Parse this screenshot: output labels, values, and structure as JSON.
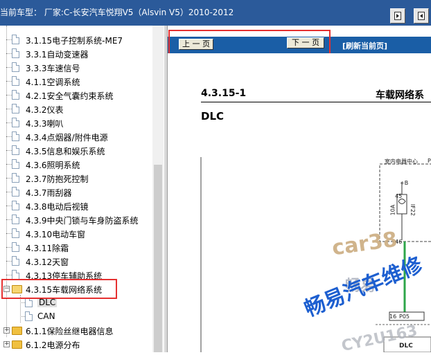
{
  "header": {
    "title": "当前车型： 厂家:C-长安汽车悦翔V5（Alsvin V5）2010-2012",
    "btn_next_icon": "page-forward-icon",
    "btn_prev_icon": "page-back-icon"
  },
  "tree": {
    "items": [
      {
        "label": "3.1.15电子控制系统-ME7"
      },
      {
        "label": "3.3.1自动变速器"
      },
      {
        "label": "3.3.3车速信号"
      },
      {
        "label": "4.1.1空调系统"
      },
      {
        "label": "4.2.1安全气囊约束系统"
      },
      {
        "label": "4.3.2仪表"
      },
      {
        "label": "4.3.3喇叭"
      },
      {
        "label": "4.3.4点烟器/附件电源"
      },
      {
        "label": "4.3.5信息和娱乐系统"
      },
      {
        "label": "4.3.6照明系统"
      },
      {
        "label": "2.3.7防抱死控制"
      },
      {
        "label": "4.3.7雨刮器"
      },
      {
        "label": "4.3.8电动后视镜"
      },
      {
        "label": "4.3.9中央门锁与车身防盗系统"
      },
      {
        "label": "4.3.10电动车窗"
      },
      {
        "label": "4.3.11除霜"
      },
      {
        "label": "4.3.12天窗"
      },
      {
        "label": "4.3.13停车辅助系统"
      }
    ],
    "open_folder": {
      "label": "4.3.15车载网络系统",
      "children": [
        "DLC",
        "CAN"
      ]
    },
    "closed_folders": [
      {
        "label": "6.1.1保险丝继电器信息"
      },
      {
        "label": "6.1.2电源分布"
      }
    ]
  },
  "nav": {
    "prev": "上 一 页",
    "next": "下 一 页",
    "refresh": "[刷新当前页]"
  },
  "document": {
    "section_no": "4.3.15-1",
    "section_title": "车载网络系",
    "subtitle": "DLC",
    "diagram": {
      "box_label": "室内电器中心",
      "box_label_suffix": "P",
      "plus_b": "+B",
      "pin_top": "45",
      "pin_bottom": "46",
      "fuse_rating": "10A",
      "fuse_name": "IF22",
      "pin_16": "16",
      "connector": "P05",
      "bottom_label": "DLC"
    },
    "watermarks": [
      "car38",
      "畅易",
      "畅易汽车维修",
      "CY2U163"
    ]
  },
  "colors": {
    "topbar": "#2b5a9a",
    "navbar": "#1a5ea6",
    "highlight_box": "#e53030",
    "wire": "#2ea64a",
    "watermark_blue": "#1d5fd0"
  }
}
